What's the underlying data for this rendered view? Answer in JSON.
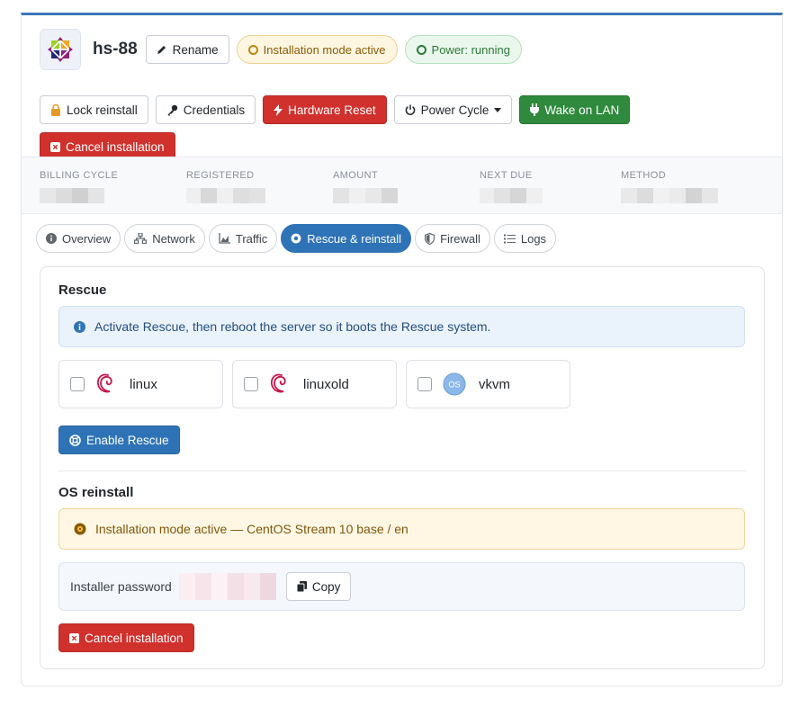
{
  "server": {
    "hostname": "hs-88",
    "rename_label": "Rename",
    "status_install": "Installation mode active",
    "status_power": "Power: running"
  },
  "actions": {
    "lock_reinstall": "Lock reinstall",
    "credentials": "Credentials",
    "hardware_reset": "Hardware Reset",
    "power_cycle": "Power Cycle",
    "wake_on_lan": "Wake on LAN",
    "cancel_installation": "Cancel installation"
  },
  "billing": {
    "columns": [
      {
        "label": "BILLING CYCLE"
      },
      {
        "label": "REGISTERED"
      },
      {
        "label": "AMOUNT"
      },
      {
        "label": "NEXT DUE"
      },
      {
        "label": "METHOD"
      }
    ]
  },
  "tabs": [
    {
      "label": "Overview",
      "icon": "info-circle-icon",
      "active": false
    },
    {
      "label": "Network",
      "icon": "network-icon",
      "active": false
    },
    {
      "label": "Traffic",
      "icon": "chart-area-icon",
      "active": false
    },
    {
      "label": "Rescue & reinstall",
      "icon": "lifebuoy-icon",
      "active": true
    },
    {
      "label": "Firewall",
      "icon": "shield-icon",
      "active": false
    },
    {
      "label": "Logs",
      "icon": "list-icon",
      "active": false
    }
  ],
  "rescue": {
    "title": "Rescue",
    "info": "Activate Rescue, then reboot the server so it boots the Rescue system.",
    "options": [
      {
        "name": "linux",
        "icon": "debian-icon"
      },
      {
        "name": "linuxold",
        "icon": "debian-icon"
      },
      {
        "name": "vkvm",
        "icon": "os-icon",
        "icon_text": "OS"
      }
    ],
    "enable_label": "Enable Rescue"
  },
  "reinstall": {
    "title": "OS reinstall",
    "status": "Installation mode active — CentOS Stream 10 base / en",
    "password_label": "Installer password",
    "copy_label": "Copy",
    "cancel_label": "Cancel installation"
  },
  "colors": {
    "accent": "#2f73b7",
    "danger": "#d0312d",
    "success": "#2f8a3e",
    "warning_bg": "#fff7e4"
  }
}
